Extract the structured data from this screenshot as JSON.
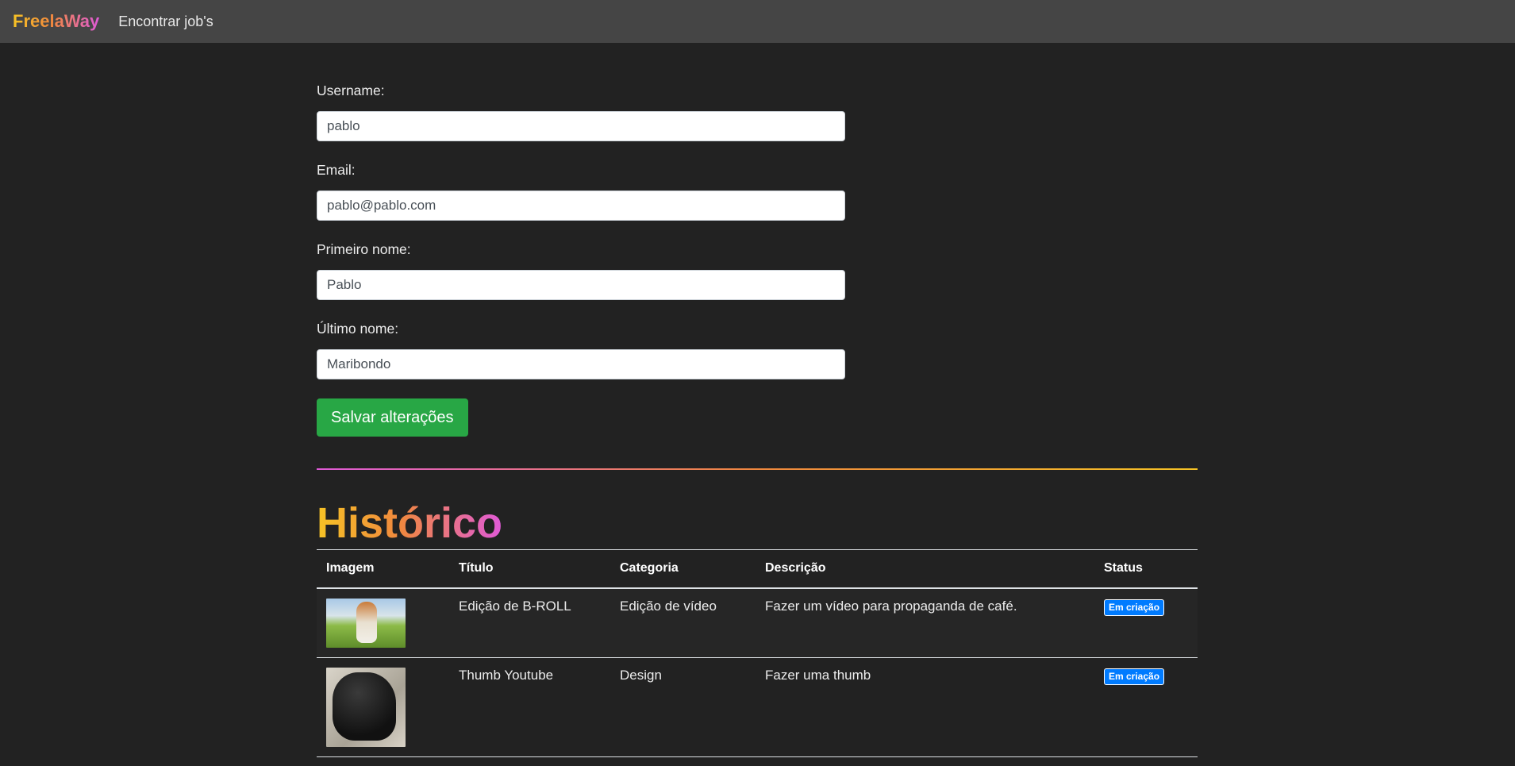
{
  "navbar": {
    "brand": "FreelaWay",
    "link": "Encontrar job's"
  },
  "form": {
    "username": {
      "label": "Username:",
      "value": "pablo"
    },
    "email": {
      "label": "Email:",
      "value": "pablo@pablo.com"
    },
    "first_name": {
      "label": "Primeiro nome:",
      "value": "Pablo"
    },
    "last_name": {
      "label": "Último nome:",
      "value": "Maribondo"
    },
    "save_label": "Salvar alterações"
  },
  "history": {
    "title": "Histórico",
    "columns": [
      "Imagem",
      "Título",
      "Categoria",
      "Descrição",
      "Status"
    ],
    "rows": [
      {
        "image": "dog-running-photo",
        "title": "Edição de B-ROLL",
        "category": "Edição de vídeo",
        "description": "Fazer um vídeo para propaganda de café.",
        "status": "Em criação"
      },
      {
        "image": "black-puppy-photo",
        "title": "Thumb Youtube",
        "category": "Design",
        "description": "Fazer uma thumb",
        "status": "Em criação"
      }
    ]
  },
  "colors": {
    "background": "#222222",
    "navbar": "#454545",
    "accent_yellow": "#f6c325",
    "accent_pink": "#e05ad8",
    "button_green": "#28a745",
    "badge_blue": "#007bff"
  }
}
